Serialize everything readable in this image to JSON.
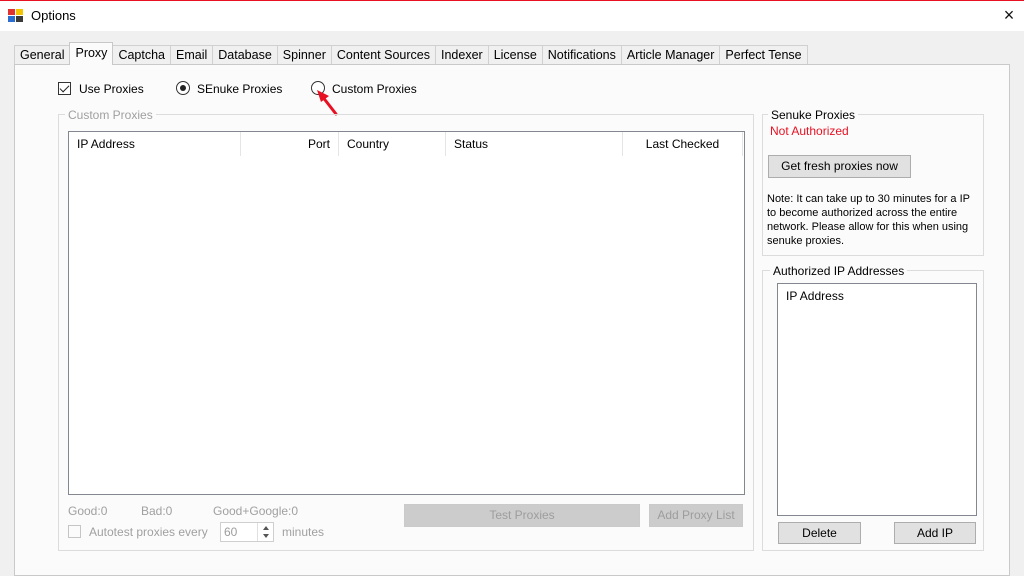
{
  "window": {
    "title": "Options",
    "close_icon": "×"
  },
  "tabs": [
    "General",
    "Proxy",
    "Captcha",
    "Email",
    "Database",
    "Spinner",
    "Content Sources",
    "Indexer",
    "License",
    "Notifications",
    "Article Manager",
    "Perfect Tense"
  ],
  "active_tab": "Proxy",
  "proxy": {
    "use_proxies_label": "Use Proxies",
    "use_proxies_checked": true,
    "senuke_proxies_label": "SEnuke Proxies",
    "custom_proxies_label": "Custom Proxies",
    "selected_mode": "SEnuke Proxies"
  },
  "custom_proxies": {
    "group_title": "Custom Proxies",
    "columns": [
      "IP Address",
      "Port",
      "Country",
      "Status",
      "Last Checked"
    ],
    "rows": [],
    "stats": {
      "good": "Good:0",
      "bad": "Bad:0",
      "good_google": "Good+Google:0"
    },
    "autotest_label": "Autotest proxies every",
    "autotest_value": "60",
    "autotest_unit": "minutes",
    "test_button": "Test Proxies",
    "add_list_button": "Add Proxy List"
  },
  "senuke_proxies": {
    "group_title": "Senuke Proxies",
    "status": "Not Authorized",
    "status_color": "#e81123",
    "get_button": "Get fresh proxies now",
    "note": "Note: It can take up to 30 minutes for a IP to become authorized across the entire network. Please allow for this when using senuke proxies."
  },
  "authorized_ips": {
    "group_title": "Authorized IP Addresses",
    "column": "IP Address",
    "rows": [],
    "delete_button": "Delete",
    "add_button": "Add IP"
  },
  "annotation": {
    "icon": "red-arrow-icon",
    "color": "#e81123"
  }
}
